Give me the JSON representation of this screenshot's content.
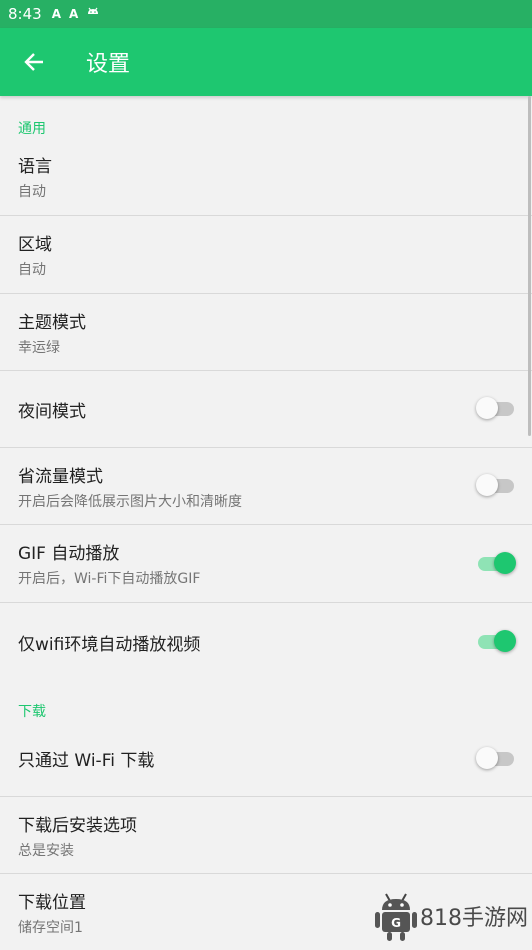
{
  "status_bar": {
    "time": "8:43",
    "icons": [
      "A",
      "A",
      "android-icon"
    ]
  },
  "app_bar": {
    "title": "设置"
  },
  "sections": {
    "general": "通用",
    "download": "下载"
  },
  "items": {
    "language": {
      "title": "语言",
      "sub": "自动"
    },
    "region": {
      "title": "区域",
      "sub": "自动"
    },
    "theme": {
      "title": "主题模式",
      "sub": "幸运绿"
    },
    "night": {
      "title": "夜间模式",
      "on": false
    },
    "data_saver": {
      "title": "省流量模式",
      "sub": "开启后会降低展示图片大小和清晰度",
      "on": false
    },
    "gif_autoplay": {
      "title": "GIF 自动播放",
      "sub": "开启后，Wi-Fi下自动播放GIF",
      "on": true
    },
    "wifi_video": {
      "title": "仅wifi环境自动播放视频",
      "on": true
    },
    "wifi_download": {
      "title": "只通过 Wi-Fi 下载",
      "on": false
    },
    "install_option": {
      "title": "下载后安装选项",
      "sub": "总是安装"
    },
    "download_location": {
      "title": "下载位置",
      "sub": "储存空间1"
    }
  },
  "watermark": {
    "text": "818手游网",
    "badge": "G"
  },
  "colors": {
    "accent": "#1ec770",
    "status": "#27b064",
    "background": "#f2f2f2"
  }
}
